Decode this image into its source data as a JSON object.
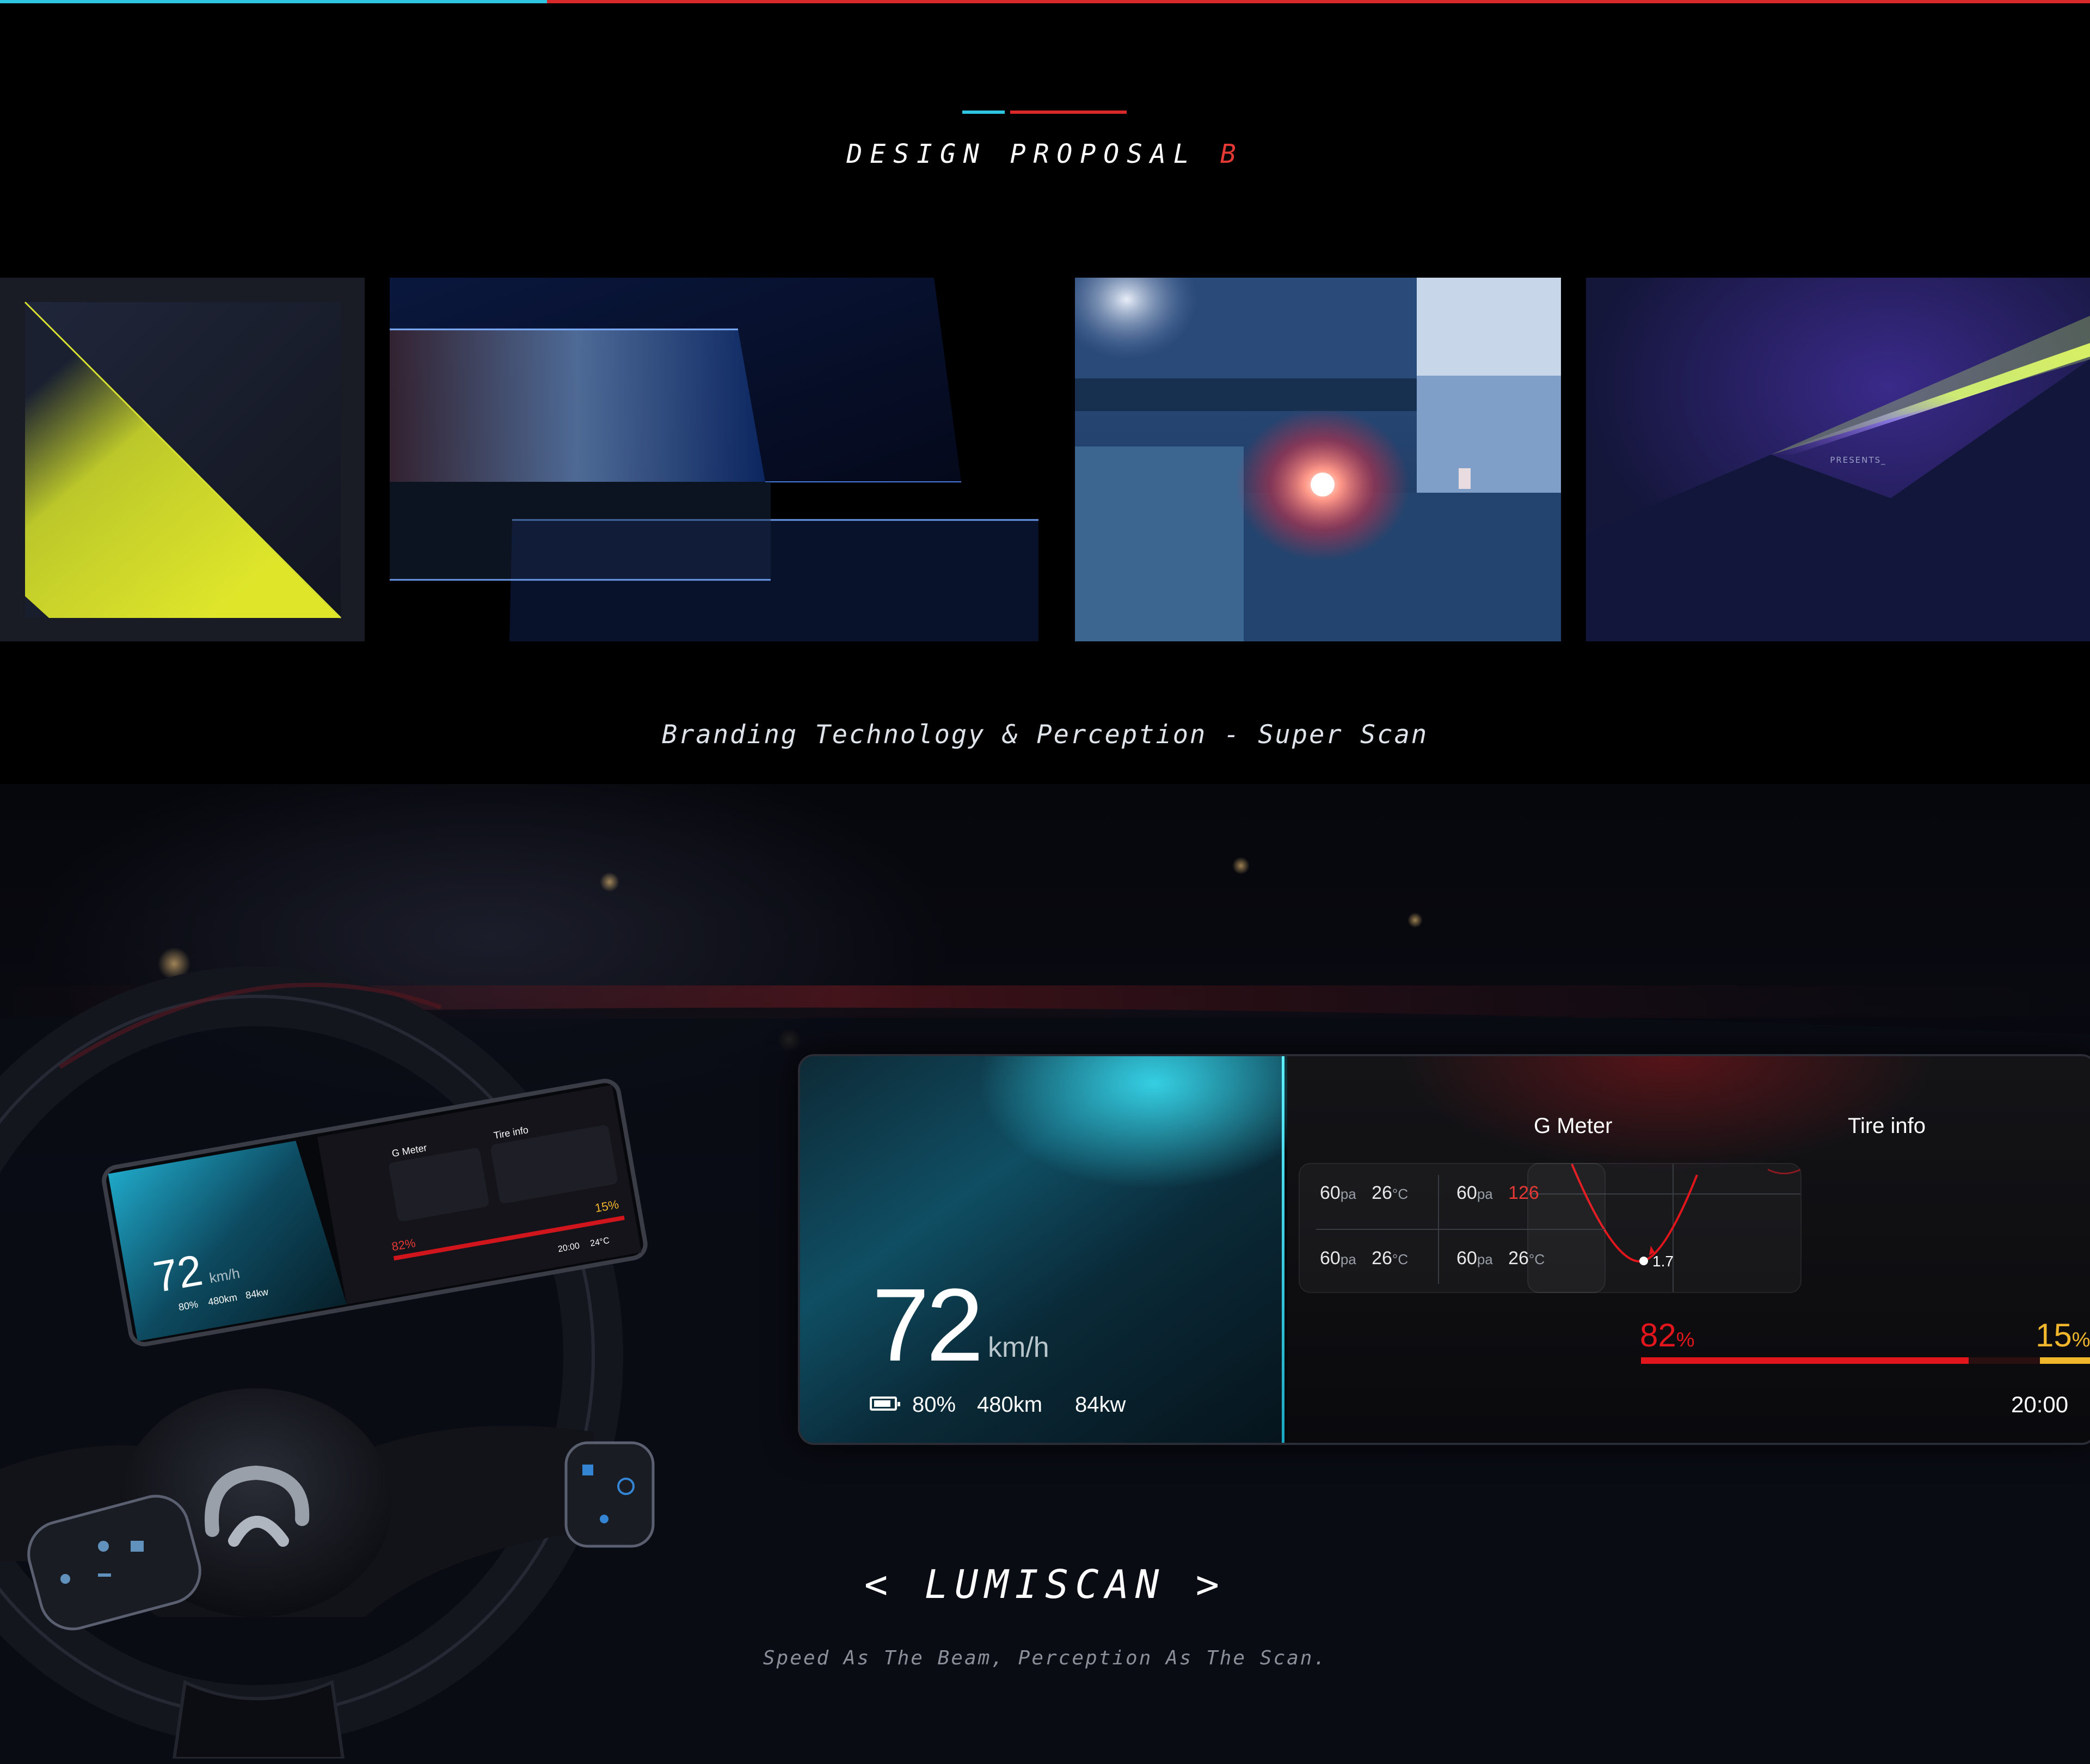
{
  "header": {
    "title": "DESIGN PROPOSAL",
    "title_accent": "B"
  },
  "gallery": {
    "tiles": [
      {
        "name": "yellow-triangle-gradient"
      },
      {
        "name": "blue-glass-panels"
      },
      {
        "name": "blue-room-light"
      },
      {
        "name": "purple-beam-presents",
        "overlay_text": "PRESENTS_"
      }
    ],
    "caption": "Branding Technology & Perception - Super Scan"
  },
  "dashboard": {
    "speed": "72",
    "speed_unit": "km/h",
    "battery_percent": "80%",
    "range": "480km",
    "power": "84kw",
    "g_meter": {
      "title": "G Meter",
      "value": "1.7"
    },
    "tire_info": {
      "title": "Tire info",
      "readings": [
        {
          "pressure": "60",
          "pressure_unit": "pa",
          "temp": "26",
          "temp_unit": "°C"
        },
        {
          "pressure": "60",
          "pressure_unit": "pa",
          "temp": "126",
          "temp_unit": "",
          "alert": true
        },
        {
          "pressure": "60",
          "pressure_unit": "pa",
          "temp": "26",
          "temp_unit": "°C"
        },
        {
          "pressure": "60",
          "pressure_unit": "pa",
          "temp": "26",
          "temp_unit": "°C"
        }
      ]
    },
    "level_left": {
      "value": "82",
      "unit": "%",
      "fraction": 0.82
    },
    "level_right": {
      "value": "15",
      "unit": "%",
      "fraction": 0.15
    },
    "clock": "20:00"
  },
  "mini_display": {
    "speed": "72",
    "speed_unit": "km/h",
    "battery_percent": "80%",
    "range": "480km",
    "power": "84kw",
    "g_meter_title": "G Meter",
    "tire_title": "Tire info",
    "level_left": "82%",
    "level_right": "15%",
    "clock": "20:00",
    "temp": "24°C"
  },
  "product": {
    "name": "< LUMISCAN >",
    "tagline": "Speed As The Beam, Perception As The Scan."
  },
  "colors": {
    "accent_cyan": "#2ec6e0",
    "accent_red": "#d82a2a",
    "level_red": "#e0161c",
    "level_yellow": "#f0b62c",
    "background": "#000000"
  }
}
